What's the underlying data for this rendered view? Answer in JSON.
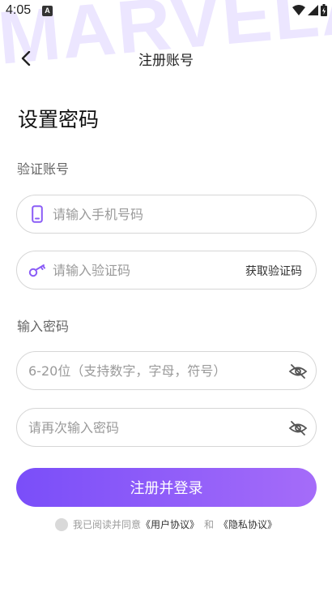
{
  "watermark": "MARVELA",
  "status_bar": {
    "time": "4:05",
    "notification_badge": "A"
  },
  "nav": {
    "title": "注册账号"
  },
  "heading": "设置密码",
  "account_section": {
    "label": "验证账号",
    "phone_placeholder": "请输入手机号码",
    "code_placeholder": "请输入验证码",
    "get_code_label": "获取验证码"
  },
  "password_section": {
    "label": "输入密码",
    "password_placeholder": "6-20位（支持数字，字母，符号）",
    "confirm_placeholder": "请再次输入密码"
  },
  "submit_label": "注册并登录",
  "agreement": {
    "prefix": "我已阅读并同意",
    "user_agreement": "《用户协议》",
    "conjunction": "和",
    "privacy_agreement": "《隐私协议》",
    "checked": false
  },
  "colors": {
    "accent_start": "#7a4ef9",
    "accent_end": "#a56cf9",
    "icon": "#8a5cf6"
  }
}
